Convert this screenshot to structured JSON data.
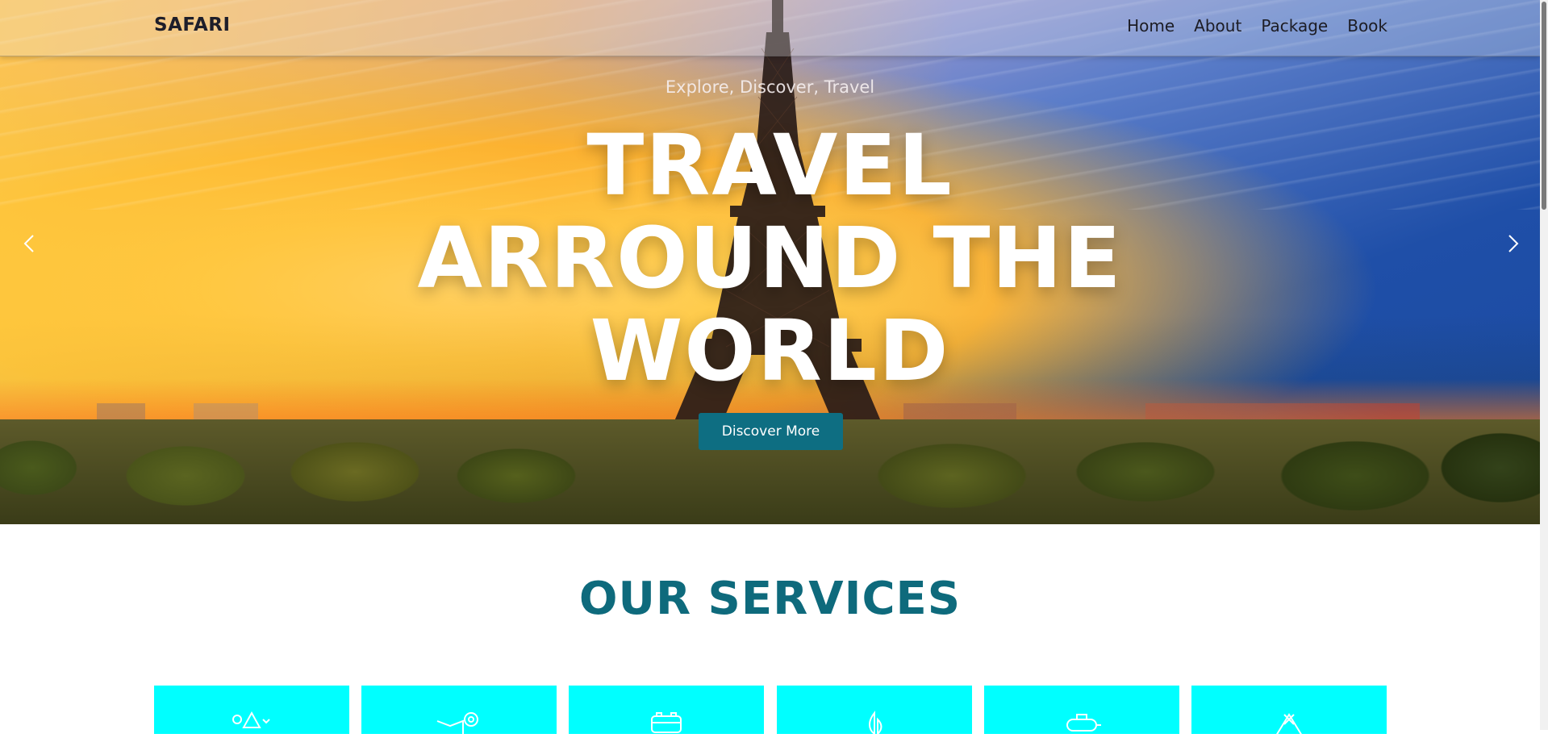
{
  "navbar": {
    "brand": "SAFARI",
    "links": [
      "Home",
      "About",
      "Package",
      "Book"
    ]
  },
  "hero": {
    "subtitle": "Explore, Discover, Travel",
    "title_lines": [
      "TRAVEL",
      "ARROUND THE",
      "WORLD"
    ],
    "cta_label": "Discover More",
    "prev_icon": "chevron-left-icon",
    "next_icon": "chevron-right-icon"
  },
  "services": {
    "title": "OUR SERVICES",
    "cards": [
      {
        "icon": "hiking-icon"
      },
      {
        "icon": "map-pin-icon"
      },
      {
        "icon": "bus-icon"
      },
      {
        "icon": "sailboat-icon"
      },
      {
        "icon": "submarine-icon"
      },
      {
        "icon": "tent-icon"
      }
    ]
  },
  "colors": {
    "accent": "#0e6e82",
    "services_title": "#0e6a7c",
    "card_bg": "#00ffff"
  }
}
